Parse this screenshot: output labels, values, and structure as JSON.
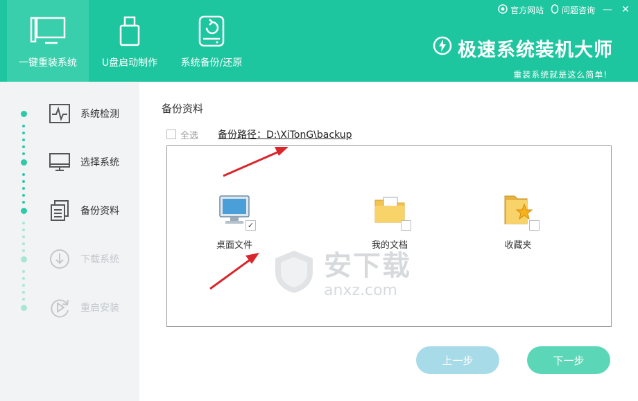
{
  "topbar": {
    "website": "官方网站",
    "help": "问题咨询",
    "minimize": "—",
    "close": "✕"
  },
  "tabs": [
    {
      "label": "一键重装系统",
      "icon": "monitor-icon"
    },
    {
      "label": "U盘启动制作",
      "icon": "usb-drive-icon"
    },
    {
      "label": "系统备份/还原",
      "icon": "backup-restore-icon"
    }
  ],
  "brand": {
    "title": "极速系统装机大师",
    "slogan": "重装系统就是这么简单!"
  },
  "steps": [
    {
      "label": "系统检测",
      "state": "done"
    },
    {
      "label": "选择系统",
      "state": "done"
    },
    {
      "label": "备份资料",
      "state": "active"
    },
    {
      "label": "下载系统",
      "state": "pending"
    },
    {
      "label": "重启安装",
      "state": "pending"
    }
  ],
  "main": {
    "section_title": "备份资料",
    "select_all": "全选",
    "backup_path": "备份路径：D:\\XiTonG\\backup",
    "items": [
      {
        "label": "桌面文件",
        "checked": true
      },
      {
        "label": "我的文档",
        "checked": false
      },
      {
        "label": "收藏夹",
        "checked": false
      }
    ],
    "prev_button": "上一步",
    "next_button": "下一步"
  },
  "watermark": {
    "text": "安下载",
    "domain": "anxz.com"
  },
  "colors": {
    "header": "#1ec6a0",
    "active_tab": "#39cfac",
    "next": "#5bd7b7",
    "prev": "#a8dbe8",
    "arrow": "#d9262c"
  }
}
